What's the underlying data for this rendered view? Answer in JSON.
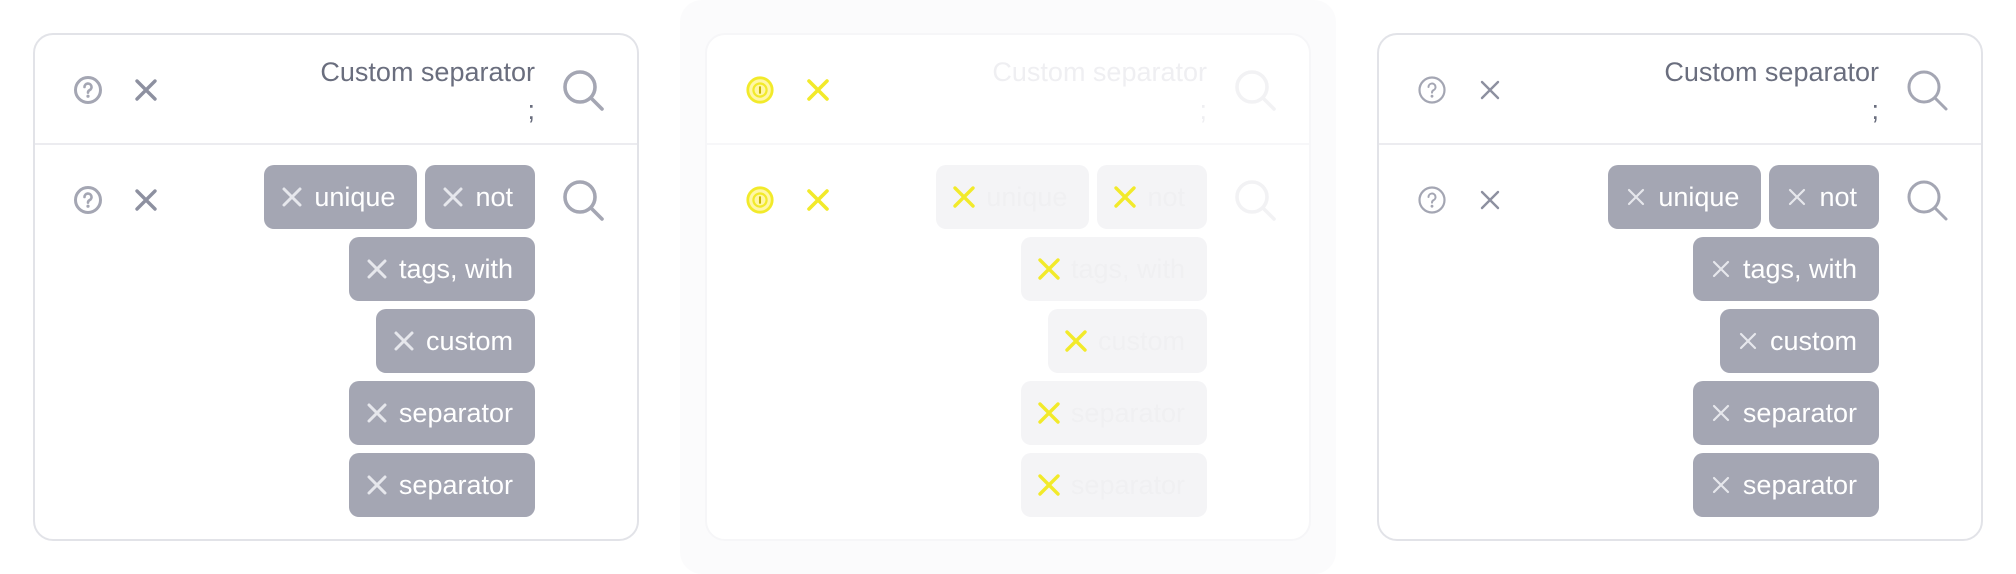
{
  "colors": {
    "tag_bg": "#a4a6b3",
    "icon": "#a4a6b3",
    "highlight_yellow": "#f5f03a"
  },
  "panels": [
    {
      "variant": "normal",
      "separator_field": {
        "label": "Custom separator",
        "value": ";"
      },
      "tags": [
        "unique",
        "not",
        "tags, with",
        "custom",
        "separator",
        "separator"
      ],
      "icons": {
        "help": "help-circle-icon",
        "clear": "close-icon",
        "search": "search-icon"
      }
    },
    {
      "variant": "ghost",
      "separator_field": {
        "label": "Custom separator",
        "value": ";"
      },
      "tags": [
        "unique",
        "not",
        "tags, with",
        "custom",
        "separator",
        "separator"
      ],
      "icons": {
        "help": "lightbulb-icon",
        "clear": "close-icon",
        "search": "search-icon"
      }
    },
    {
      "variant": "light",
      "separator_field": {
        "label": "Custom separator",
        "value": ";"
      },
      "tags": [
        "unique",
        "not",
        "tags, with",
        "custom",
        "separator",
        "separator"
      ],
      "icons": {
        "help": "help-circle-icon",
        "clear": "close-icon",
        "search": "search-icon"
      }
    }
  ]
}
